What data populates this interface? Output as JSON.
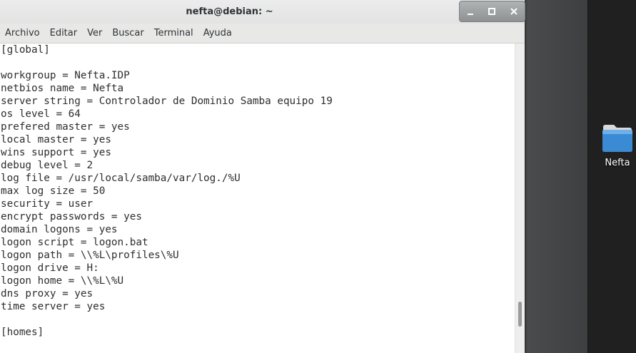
{
  "window": {
    "title": "nefta@debian: ~",
    "minimize_icon": "minimize-icon",
    "maximize_icon": "maximize-icon",
    "close_icon": "close-icon"
  },
  "menubar": {
    "items": [
      "Archivo",
      "Editar",
      "Ver",
      "Buscar",
      "Terminal",
      "Ayuda"
    ]
  },
  "terminal": {
    "lines": [
      "[global]",
      "",
      "workgroup = Nefta.IDP",
      "netbios name = Nefta",
      "server string = Controlador de Dominio Samba equipo 19",
      "os level = 64",
      "prefered master = yes",
      "local master = yes",
      "wins support = yes",
      "debug level = 2",
      "log file = /usr/local/samba/var/log./%U",
      "max log size = 50",
      "security = user",
      "encrypt passwords = yes",
      "domain logons = yes",
      "logon script = logon.bat",
      "logon path = \\\\%L\\profiles\\%U",
      "logon drive = H:",
      "logon home = \\\\%L\\%U",
      "dns proxy = yes",
      "time server = yes",
      "",
      "[homes]"
    ]
  },
  "desktop": {
    "folder_label": "Nefta",
    "folder_icon": "folder-icon"
  },
  "colors": {
    "folder_blue": "#4a90d9",
    "terminal_bg": "#ffffff",
    "terminal_fg": "#2e2e2e"
  }
}
